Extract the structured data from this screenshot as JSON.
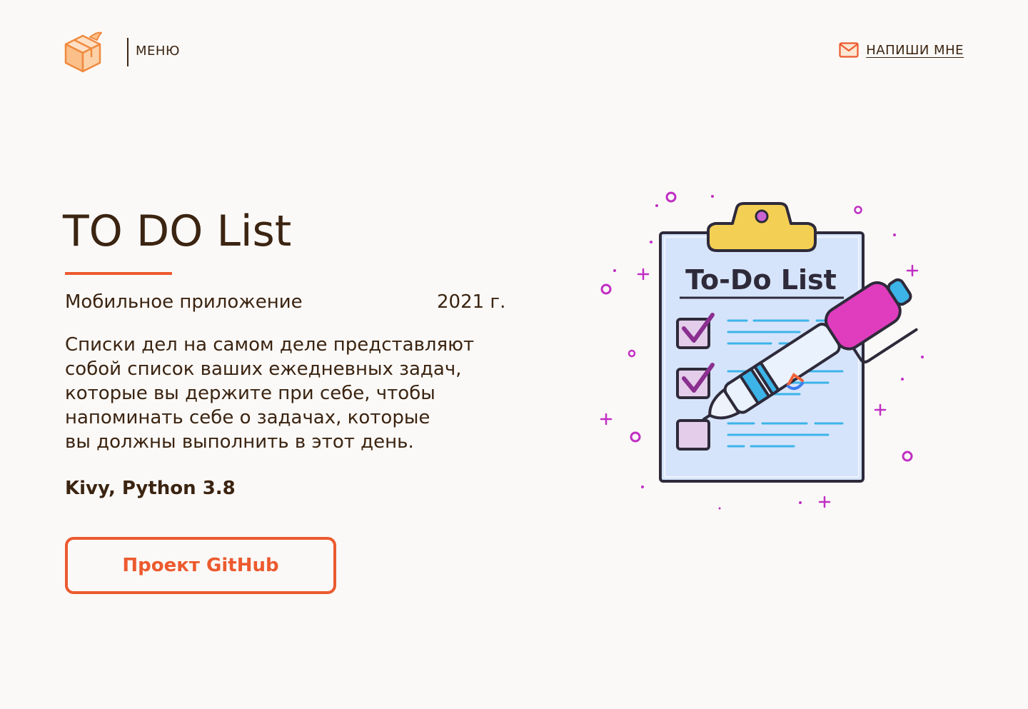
{
  "header": {
    "menu_label": "МЕНЮ",
    "contact_label": "НАПИШИ МНЕ"
  },
  "project": {
    "title": "TO DO List",
    "type": "Мобильное приложение",
    "year": "2021 г.",
    "description_lines": [
      "Списки дел на самом деле представляют",
      "собой список ваших ежедневных задач,",
      "которые вы держите при себе, чтобы",
      "напоминать себе о задачах, которые",
      "вы должны выполнить в этот день."
    ],
    "stack": "Kivy, Python 3.8",
    "cta_label": "Проект GitHub"
  },
  "illustration": {
    "heading": "To-Do List"
  },
  "colors": {
    "background": "#fbf9f7",
    "text": "#3b2411",
    "accent": "#ec5a2f",
    "clipboard_fill": "#d6e4fb",
    "marker_pink": "#e03cbe",
    "clip_yellow": "#f3cf54",
    "check_purple": "#8a2f8f"
  },
  "icons": [
    "box-logo-icon",
    "mail-icon"
  ]
}
